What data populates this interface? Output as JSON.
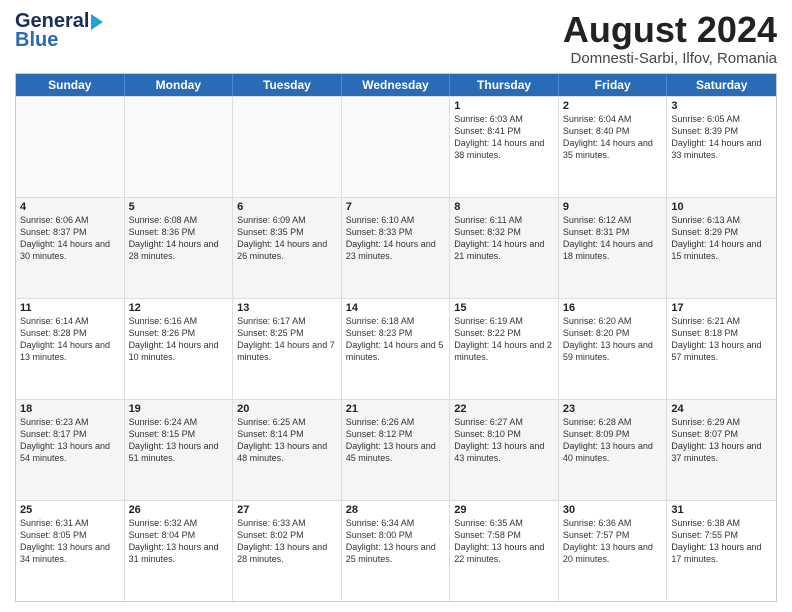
{
  "header": {
    "logo_line1": "General",
    "logo_line2": "Blue",
    "month_year": "August 2024",
    "location": "Domnesti-Sarbi, Ilfov, Romania"
  },
  "weekdays": [
    "Sunday",
    "Monday",
    "Tuesday",
    "Wednesday",
    "Thursday",
    "Friday",
    "Saturday"
  ],
  "rows": [
    [
      {
        "day": "",
        "sunrise": "",
        "sunset": "",
        "daylight": "",
        "empty": true
      },
      {
        "day": "",
        "sunrise": "",
        "sunset": "",
        "daylight": "",
        "empty": true
      },
      {
        "day": "",
        "sunrise": "",
        "sunset": "",
        "daylight": "",
        "empty": true
      },
      {
        "day": "",
        "sunrise": "",
        "sunset": "",
        "daylight": "",
        "empty": true
      },
      {
        "day": "1",
        "sunrise": "Sunrise: 6:03 AM",
        "sunset": "Sunset: 8:41 PM",
        "daylight": "Daylight: 14 hours and 38 minutes."
      },
      {
        "day": "2",
        "sunrise": "Sunrise: 6:04 AM",
        "sunset": "Sunset: 8:40 PM",
        "daylight": "Daylight: 14 hours and 35 minutes."
      },
      {
        "day": "3",
        "sunrise": "Sunrise: 6:05 AM",
        "sunset": "Sunset: 8:39 PM",
        "daylight": "Daylight: 14 hours and 33 minutes."
      }
    ],
    [
      {
        "day": "4",
        "sunrise": "Sunrise: 6:06 AM",
        "sunset": "Sunset: 8:37 PM",
        "daylight": "Daylight: 14 hours and 30 minutes."
      },
      {
        "day": "5",
        "sunrise": "Sunrise: 6:08 AM",
        "sunset": "Sunset: 8:36 PM",
        "daylight": "Daylight: 14 hours and 28 minutes."
      },
      {
        "day": "6",
        "sunrise": "Sunrise: 6:09 AM",
        "sunset": "Sunset: 8:35 PM",
        "daylight": "Daylight: 14 hours and 26 minutes."
      },
      {
        "day": "7",
        "sunrise": "Sunrise: 6:10 AM",
        "sunset": "Sunset: 8:33 PM",
        "daylight": "Daylight: 14 hours and 23 minutes."
      },
      {
        "day": "8",
        "sunrise": "Sunrise: 6:11 AM",
        "sunset": "Sunset: 8:32 PM",
        "daylight": "Daylight: 14 hours and 21 minutes."
      },
      {
        "day": "9",
        "sunrise": "Sunrise: 6:12 AM",
        "sunset": "Sunset: 8:31 PM",
        "daylight": "Daylight: 14 hours and 18 minutes."
      },
      {
        "day": "10",
        "sunrise": "Sunrise: 6:13 AM",
        "sunset": "Sunset: 8:29 PM",
        "daylight": "Daylight: 14 hours and 15 minutes."
      }
    ],
    [
      {
        "day": "11",
        "sunrise": "Sunrise: 6:14 AM",
        "sunset": "Sunset: 8:28 PM",
        "daylight": "Daylight: 14 hours and 13 minutes."
      },
      {
        "day": "12",
        "sunrise": "Sunrise: 6:16 AM",
        "sunset": "Sunset: 8:26 PM",
        "daylight": "Daylight: 14 hours and 10 minutes."
      },
      {
        "day": "13",
        "sunrise": "Sunrise: 6:17 AM",
        "sunset": "Sunset: 8:25 PM",
        "daylight": "Daylight: 14 hours and 7 minutes."
      },
      {
        "day": "14",
        "sunrise": "Sunrise: 6:18 AM",
        "sunset": "Sunset: 8:23 PM",
        "daylight": "Daylight: 14 hours and 5 minutes."
      },
      {
        "day": "15",
        "sunrise": "Sunrise: 6:19 AM",
        "sunset": "Sunset: 8:22 PM",
        "daylight": "Daylight: 14 hours and 2 minutes."
      },
      {
        "day": "16",
        "sunrise": "Sunrise: 6:20 AM",
        "sunset": "Sunset: 8:20 PM",
        "daylight": "Daylight: 13 hours and 59 minutes."
      },
      {
        "day": "17",
        "sunrise": "Sunrise: 6:21 AM",
        "sunset": "Sunset: 8:18 PM",
        "daylight": "Daylight: 13 hours and 57 minutes."
      }
    ],
    [
      {
        "day": "18",
        "sunrise": "Sunrise: 6:23 AM",
        "sunset": "Sunset: 8:17 PM",
        "daylight": "Daylight: 13 hours and 54 minutes."
      },
      {
        "day": "19",
        "sunrise": "Sunrise: 6:24 AM",
        "sunset": "Sunset: 8:15 PM",
        "daylight": "Daylight: 13 hours and 51 minutes."
      },
      {
        "day": "20",
        "sunrise": "Sunrise: 6:25 AM",
        "sunset": "Sunset: 8:14 PM",
        "daylight": "Daylight: 13 hours and 48 minutes."
      },
      {
        "day": "21",
        "sunrise": "Sunrise: 6:26 AM",
        "sunset": "Sunset: 8:12 PM",
        "daylight": "Daylight: 13 hours and 45 minutes."
      },
      {
        "day": "22",
        "sunrise": "Sunrise: 6:27 AM",
        "sunset": "Sunset: 8:10 PM",
        "daylight": "Daylight: 13 hours and 43 minutes."
      },
      {
        "day": "23",
        "sunrise": "Sunrise: 6:28 AM",
        "sunset": "Sunset: 8:09 PM",
        "daylight": "Daylight: 13 hours and 40 minutes."
      },
      {
        "day": "24",
        "sunrise": "Sunrise: 6:29 AM",
        "sunset": "Sunset: 8:07 PM",
        "daylight": "Daylight: 13 hours and 37 minutes."
      }
    ],
    [
      {
        "day": "25",
        "sunrise": "Sunrise: 6:31 AM",
        "sunset": "Sunset: 8:05 PM",
        "daylight": "Daylight: 13 hours and 34 minutes."
      },
      {
        "day": "26",
        "sunrise": "Sunrise: 6:32 AM",
        "sunset": "Sunset: 8:04 PM",
        "daylight": "Daylight: 13 hours and 31 minutes."
      },
      {
        "day": "27",
        "sunrise": "Sunrise: 6:33 AM",
        "sunset": "Sunset: 8:02 PM",
        "daylight": "Daylight: 13 hours and 28 minutes."
      },
      {
        "day": "28",
        "sunrise": "Sunrise: 6:34 AM",
        "sunset": "Sunset: 8:00 PM",
        "daylight": "Daylight: 13 hours and 25 minutes."
      },
      {
        "day": "29",
        "sunrise": "Sunrise: 6:35 AM",
        "sunset": "Sunset: 7:58 PM",
        "daylight": "Daylight: 13 hours and 22 minutes."
      },
      {
        "day": "30",
        "sunrise": "Sunrise: 6:36 AM",
        "sunset": "Sunset: 7:57 PM",
        "daylight": "Daylight: 13 hours and 20 minutes."
      },
      {
        "day": "31",
        "sunrise": "Sunrise: 6:38 AM",
        "sunset": "Sunset: 7:55 PM",
        "daylight": "Daylight: 13 hours and 17 minutes."
      }
    ]
  ]
}
